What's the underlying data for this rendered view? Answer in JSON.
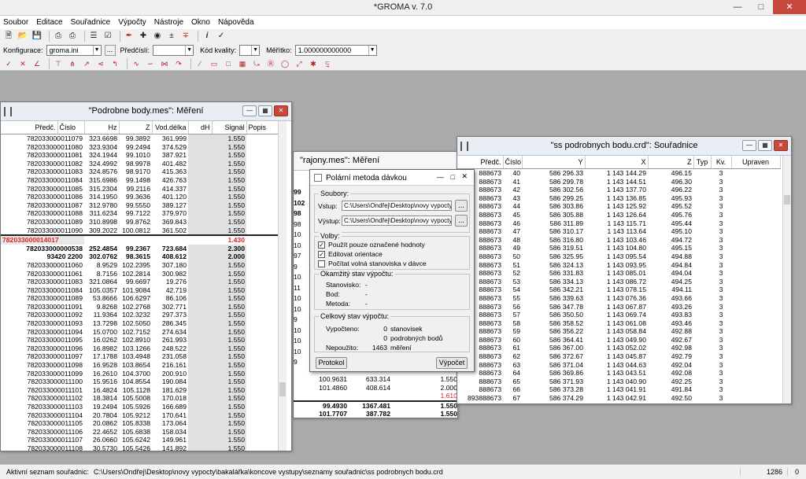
{
  "app": {
    "title": "*GROMA v. 7.0"
  },
  "menu": [
    "Soubor",
    "Editace",
    "Souřadnice",
    "Výpočty",
    "Nástroje",
    "Okno",
    "Nápověda"
  ],
  "toolbar2": {
    "konfigurace_label": "Konfigurace:",
    "konfigurace_value": "groma.ini",
    "predcisli_label": "Předčíslí:",
    "predcisli_value": "",
    "kod_label": "Kód kvality:",
    "kod_value": "",
    "meritko_label": "Měřítko:",
    "meritko_value": "1.000000000000",
    "browse": "..."
  },
  "win1": {
    "title": "\"Podrobne body.mes\": Měření",
    "headers": [
      "Předč.",
      "Číslo",
      "Hz",
      "Z",
      "Vod.délka",
      "dH",
      "Signál",
      "Popis"
    ],
    "rows": [
      [
        "782033000011079",
        "323.6698",
        "99.3892",
        "361.999",
        "",
        "1.550"
      ],
      [
        "782033000011080",
        "323.9304",
        "99.2494",
        "374.529",
        "",
        "1.550"
      ],
      [
        "782033000011081",
        "324.1944",
        "99.1010",
        "387.921",
        "",
        "1.550"
      ],
      [
        "782033000011082",
        "324.4992",
        "98.9978",
        "401.482",
        "",
        "1.550"
      ],
      [
        "782033000011083",
        "324.8576",
        "98.9170",
        "415.363",
        "",
        "1.550"
      ],
      [
        "782033000011084",
        "315.6986",
        "99.1498",
        "426.763",
        "",
        "1.550"
      ],
      [
        "782033000011085",
        "315.2304",
        "99.2116",
        "414.337",
        "",
        "1.550"
      ],
      [
        "782033000011086",
        "314.1950",
        "99.3636",
        "401.120",
        "",
        "1.550"
      ],
      [
        "782033000011087",
        "312.9780",
        "99.5550",
        "389.127",
        "",
        "1.550"
      ],
      [
        "782033000011088",
        "311.6234",
        "99.7122",
        "379.970",
        "",
        "1.550"
      ],
      [
        "782033000011089",
        "310.8998",
        "99.8762",
        "369.843",
        "",
        "1.550"
      ],
      [
        "782033000011090",
        "309.2022",
        "100.0812",
        "361.502",
        "",
        "1.550"
      ]
    ],
    "station": {
      "id": "782033000014017",
      "signal": "1.430"
    },
    "orient": [
      [
        "782033000000538",
        "252.4854",
        "99.2367",
        "723.684",
        "",
        "2.300"
      ],
      [
        "93420   2200",
        "302.0762",
        "98.3615",
        "408.612",
        "",
        "2.000"
      ]
    ],
    "rows2": [
      [
        "782033000011060",
        "8.9529",
        "102.2395",
        "307.180",
        "",
        "1.550"
      ],
      [
        "782033000011061",
        "8.7156",
        "102.2814",
        "300.982",
        "",
        "1.550"
      ],
      [
        "782033000011083",
        "321.0864",
        "99.6697",
        "19.276",
        "",
        "1.550"
      ],
      [
        "782033000011084",
        "105.0357",
        "101.9084",
        "42.719",
        "",
        "1.550"
      ],
      [
        "782033000011089",
        "53.8666",
        "106.6297",
        "86.106",
        "",
        "1.550"
      ],
      [
        "782033000011091",
        "9.8268",
        "102.2768",
        "302.771",
        "",
        "1.550"
      ],
      [
        "782033000011092",
        "11.9364",
        "102.3232",
        "297.373",
        "",
        "1.550"
      ],
      [
        "782033000011093",
        "13.7298",
        "102.5050",
        "286.345",
        "",
        "1.550"
      ],
      [
        "782033000011094",
        "15.0700",
        "102.7152",
        "274.634",
        "",
        "1.550"
      ],
      [
        "782033000011095",
        "16.0262",
        "102.8910",
        "261.993",
        "",
        "1.550"
      ],
      [
        "782033000011096",
        "16.8982",
        "103.1266",
        "248.522",
        "",
        "1.550"
      ],
      [
        "782033000011097",
        "17.1788",
        "103.4948",
        "231.058",
        "",
        "1.550"
      ],
      [
        "782033000011098",
        "16.9528",
        "103.8654",
        "216.161",
        "",
        "1.550"
      ],
      [
        "782033000011099",
        "16.2610",
        "104.3700",
        "200.910",
        "",
        "1.550"
      ],
      [
        "782033000011100",
        "15.9516",
        "104.8554",
        "190.084",
        "",
        "1.550"
      ],
      [
        "782033000011101",
        "16.4824",
        "105.1128",
        "181.629",
        "",
        "1.550"
      ],
      [
        "782033000011102",
        "18.3814",
        "105.5008",
        "170.018",
        "",
        "1.550"
      ],
      [
        "782033000011103",
        "19.2494",
        "105.5926",
        "166.689",
        "",
        "1.550"
      ],
      [
        "782033000011104",
        "20.7804",
        "105.9212",
        "170.641",
        "",
        "1.550"
      ],
      [
        "782033000011105",
        "20.0862",
        "105.8338",
        "173.064",
        "",
        "1.550"
      ],
      [
        "782033000011106",
        "22.4652",
        "105.6838",
        "158.034",
        "",
        "1.550"
      ],
      [
        "782033000011107",
        "26.0660",
        "105.6242",
        "149.961",
        "",
        "1.550"
      ],
      [
        "782033000011108",
        "30.5730",
        "105.5426",
        "141.892",
        "",
        "1.550"
      ],
      [
        "782033000011109",
        "35.3006",
        "105.4132",
        "131.999",
        "",
        "1.550"
      ],
      [
        "782033000011110",
        "37.9180",
        "105.3718",
        "125.178",
        "",
        "1.550"
      ]
    ]
  },
  "win2": {
    "title": "\"rajony.mes\": Měření",
    "frag": [
      "99",
      "102",
      "98",
      "98",
      "10",
      "10",
      "97",
      "9",
      "10",
      "11",
      "10",
      "10",
      "9",
      "10",
      "10",
      "10",
      "9"
    ],
    "bottom": [
      [
        "100.9631",
        "633.314",
        "",
        "1.550"
      ],
      [
        "101.4860",
        "408.614",
        "",
        "2.000"
      ],
      [
        "",
        "",
        "",
        "1.610"
      ],
      [
        "99.4930",
        "1367.481",
        "",
        "1.550"
      ],
      [
        "101.7707",
        "387.782",
        "",
        "1.550"
      ]
    ]
  },
  "win3": {
    "title": "\"ss podrobnych bodu.crd\": Souřadnice",
    "headers": [
      "Předč.",
      "Číslo",
      "Y",
      "X",
      "Z",
      "Typ",
      "Kv.",
      "Upraven"
    ],
    "rows": [
      [
        "888673",
        "40",
        "586 296.33",
        "1 143 144.29",
        "496.15",
        "",
        "3"
      ],
      [
        "888673",
        "41",
        "586 299.78",
        "1 143 144.51",
        "496.30",
        "",
        "3"
      ],
      [
        "888673",
        "42",
        "586 302.56",
        "1 143 137.70",
        "496.22",
        "",
        "3"
      ],
      [
        "888673",
        "43",
        "586 299.25",
        "1 143 136.85",
        "495.93",
        "",
        "3"
      ],
      [
        "888673",
        "44",
        "586 303.86",
        "1 143 125.92",
        "495.52",
        "",
        "3"
      ],
      [
        "888673",
        "45",
        "586 305.88",
        "1 143 126.64",
        "495.76",
        "",
        "3"
      ],
      [
        "888673",
        "46",
        "586 311.89",
        "1 143 115.71",
        "495.44",
        "",
        "3"
      ],
      [
        "888673",
        "47",
        "586 310.17",
        "1 143 113.64",
        "495.10",
        "",
        "3"
      ],
      [
        "888673",
        "48",
        "586 316.80",
        "1 143 103.46",
        "494.72",
        "",
        "3"
      ],
      [
        "888673",
        "49",
        "586 319.51",
        "1 143 104.80",
        "495.15",
        "",
        "3"
      ],
      [
        "888673",
        "50",
        "586 325.95",
        "1 143 095.54",
        "494.88",
        "",
        "3"
      ],
      [
        "888673",
        "51",
        "586 324.13",
        "1 143 093.95",
        "494.84",
        "",
        "3"
      ],
      [
        "888673",
        "52",
        "586 331.83",
        "1 143 085.01",
        "494.04",
        "",
        "3"
      ],
      [
        "888673",
        "53",
        "586 334.13",
        "1 143 086.72",
        "494.25",
        "",
        "3"
      ],
      [
        "888673",
        "54",
        "586 342.21",
        "1 143 078.15",
        "494.11",
        "",
        "3"
      ],
      [
        "888673",
        "55",
        "586 339.63",
        "1 143 076.36",
        "493.66",
        "",
        "3"
      ],
      [
        "888673",
        "56",
        "586 347.78",
        "1 143 067.87",
        "493.26",
        "",
        "3"
      ],
      [
        "888673",
        "57",
        "586 350.50",
        "1 143 069.74",
        "493.83",
        "",
        "3"
      ],
      [
        "888673",
        "58",
        "586 358.52",
        "1 143 061.08",
        "493.46",
        "",
        "3"
      ],
      [
        "888673",
        "59",
        "586 356.22",
        "1 143 058.84",
        "492.88",
        "",
        "3"
      ],
      [
        "888673",
        "60",
        "586 364.41",
        "1 143 049.90",
        "492.67",
        "",
        "3"
      ],
      [
        "888673",
        "61",
        "586 367.00",
        "1 143 052.02",
        "492.98",
        "",
        "3"
      ],
      [
        "888673",
        "62",
        "586 372.67",
        "1 143 045.87",
        "492.79",
        "",
        "3"
      ],
      [
        "888673",
        "63",
        "586 371.04",
        "1 143 044.63",
        "492.04",
        "",
        "3"
      ],
      [
        "888673",
        "64",
        "586 369.86",
        "1 143 043.51",
        "492.08",
        "",
        "3"
      ],
      [
        "888673",
        "65",
        "586 371.93",
        "1 143 040.90",
        "492.25",
        "",
        "3"
      ],
      [
        "888673",
        "66",
        "586 373.28",
        "1 143 041.91",
        "491.84",
        "",
        "3"
      ],
      [
        "893888673",
        "67",
        "586 374.29",
        "1 143 042.91",
        "492.50",
        "",
        "3"
      ],
      [
        "893888673",
        "68",
        "586 272.10",
        "1 143 263.76",
        "496.35",
        "",
        "3"
      ],
      [
        "893888673",
        "69",
        "586 271.89",
        "1 143 264.91",
        "498.37",
        "",
        "3"
      ]
    ]
  },
  "dialog": {
    "title": "Polární metoda dávkou",
    "soubory": "Soubory:",
    "vstup_label": "Vstup:",
    "vstup": "C:\\Users\\Ondřej\\Desktop\\novy vypocty",
    "vystup_label": "Výstup:",
    "vystup": "C:\\Users\\Ondřej\\Desktop\\novy vypocty",
    "browse": "...",
    "volby": "Volby:",
    "opt1": "Použít pouze označené hodnoty",
    "opt2": "Editovat orientace",
    "opt3": "Počítat volná stanoviska v dávce",
    "okamzity": "Okamžitý stav výpočtu:",
    "stanovisko": "Stanovisko:",
    "bod": "Bod:",
    "metoda": "Metoda:",
    "dash": "-",
    "celkovy": "Celkový stav výpočtu:",
    "vypocteno": "Vypočteno:",
    "v1": "0",
    "v1t": "stanovisek",
    "v2": "0",
    "v2t": "podrobných bodů",
    "nepouzito": "Nepoužito:",
    "v3": "1463",
    "v3t": "měření",
    "protokol": "Protokol",
    "vypocet": "Výpočet"
  },
  "status": {
    "label": "Aktivní seznam souřadnic:",
    "path": "C:\\Users\\Ondřej\\Desktop\\novy vypocty\\bakalářka\\koncove vystupy\\seznamy souřadnic\\ss podrobnych bodu.crd",
    "count": "1286",
    "zero": "0"
  }
}
